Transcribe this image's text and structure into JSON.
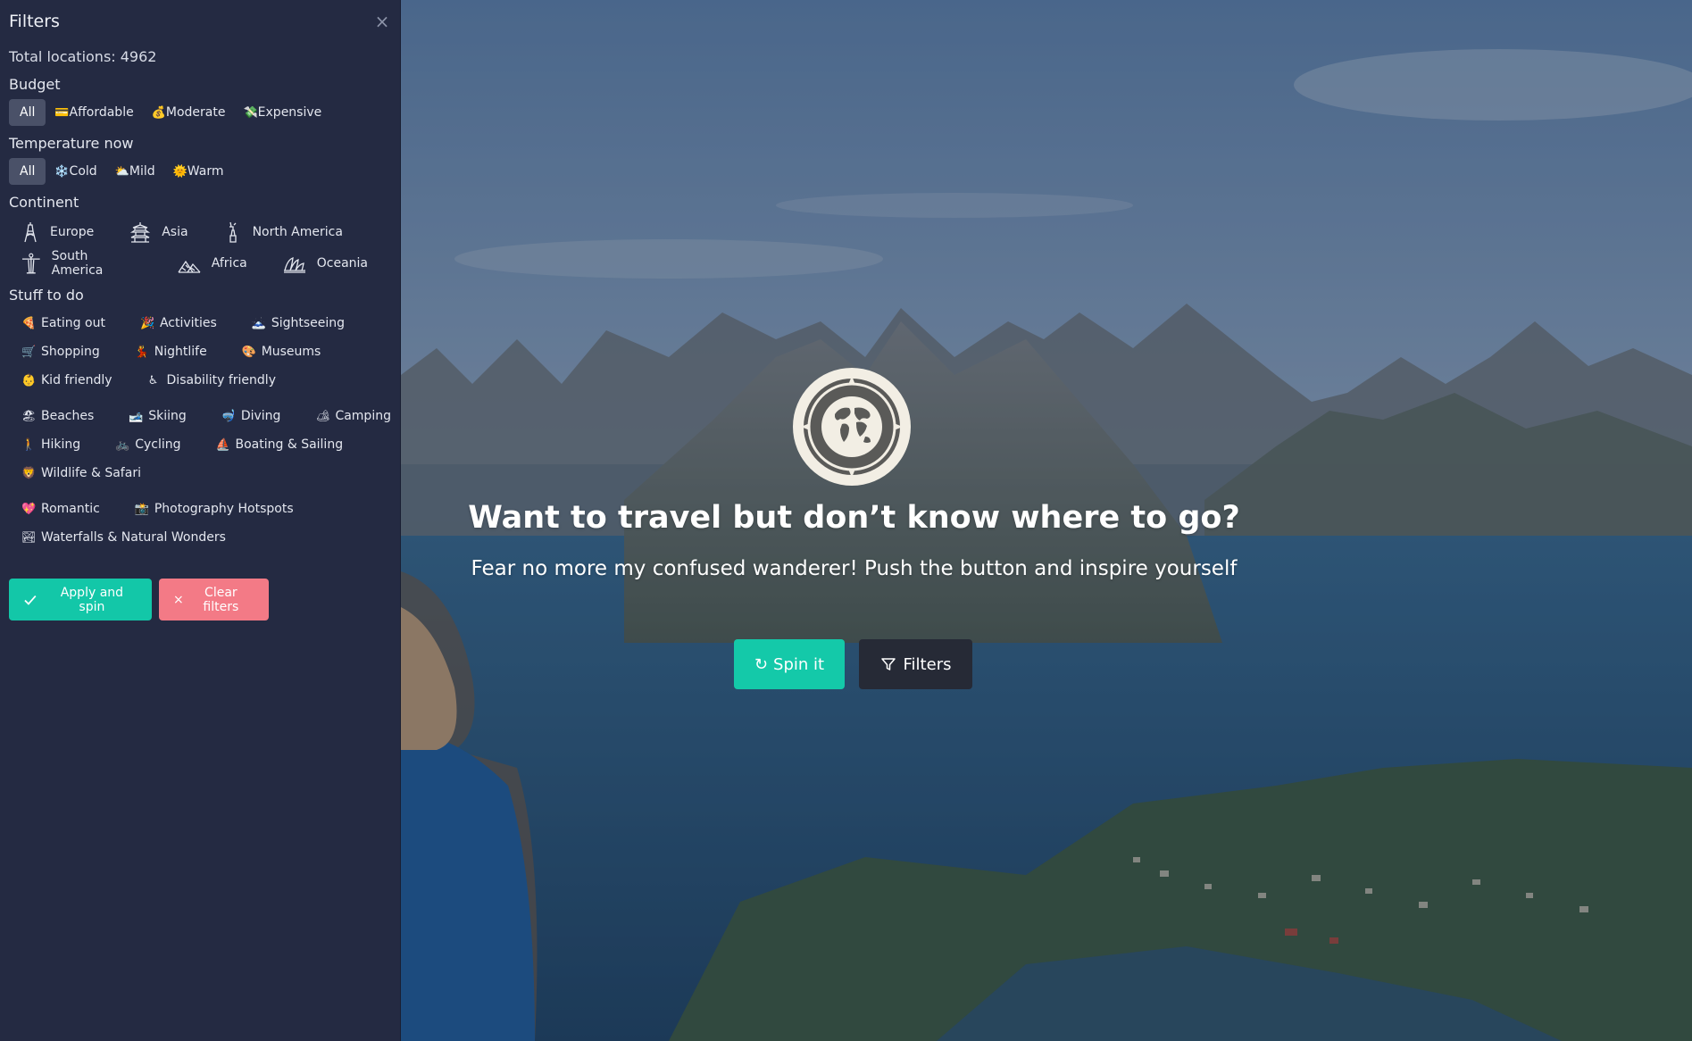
{
  "sidebar": {
    "title": "Filters",
    "close_label": "×",
    "total_locations": "Total locations: 4962",
    "budget": {
      "title": "Budget",
      "options": [
        {
          "emoji": "",
          "label": "All",
          "active": true
        },
        {
          "emoji": "💳",
          "label": "Affordable",
          "active": false
        },
        {
          "emoji": "💰",
          "label": "Moderate",
          "active": false
        },
        {
          "emoji": "💸",
          "label": "Expensive",
          "active": false
        }
      ]
    },
    "temperature": {
      "title": "Temperature now",
      "options": [
        {
          "emoji": "",
          "label": "All",
          "active": true
        },
        {
          "emoji": "❄️",
          "label": "Cold",
          "active": false
        },
        {
          "emoji": "⛅",
          "label": "Mild",
          "active": false
        },
        {
          "emoji": "🌞",
          "label": "Warm",
          "active": false
        }
      ]
    },
    "continent": {
      "title": "Continent",
      "items": [
        {
          "label": "Europe",
          "icon": "eiffel-tower-icon"
        },
        {
          "label": "Asia",
          "icon": "pagoda-icon"
        },
        {
          "label": "North America",
          "icon": "statue-of-liberty-icon"
        },
        {
          "label": "South America",
          "icon": "christ-redeemer-icon"
        },
        {
          "label": "Africa",
          "icon": "pyramids-icon"
        },
        {
          "label": "Oceania",
          "icon": "opera-house-icon"
        }
      ]
    },
    "stuff": {
      "title": "Stuff to do",
      "items": [
        {
          "emoji": "🍕",
          "label": "Eating out"
        },
        {
          "emoji": "🎉",
          "label": "Activities"
        },
        {
          "emoji": "🗻",
          "label": "Sightseeing"
        },
        {
          "emoji": "🛒",
          "label": "Shopping"
        },
        {
          "emoji": "💃",
          "label": "Nightlife"
        },
        {
          "emoji": "🎨",
          "label": "Museums"
        },
        {
          "emoji": "👶",
          "label": "Kid friendly"
        },
        {
          "emoji": "♿",
          "label": "Disability friendly"
        },
        {
          "emoji": "🏖",
          "label": "Beaches"
        },
        {
          "emoji": "🎿",
          "label": "Skiing"
        },
        {
          "emoji": "🤿",
          "label": "Diving"
        },
        {
          "emoji": "🏕",
          "label": "Camping"
        },
        {
          "emoji": "🚶",
          "label": "Hiking"
        },
        {
          "emoji": "🚲",
          "label": "Cycling"
        },
        {
          "emoji": "⛵",
          "label": "Boating & Sailing"
        },
        {
          "emoji": "🦁",
          "label": "Wildlife & Safari"
        },
        {
          "emoji": "💖",
          "label": "Romantic"
        },
        {
          "emoji": "📸",
          "label": "Photography Hotspots"
        },
        {
          "emoji": "🏞",
          "label": "Waterfalls & Natural Wonders"
        }
      ]
    },
    "apply_label": "Apply and spin",
    "clear_label": "Clear filters",
    "clear_prefix": "×"
  },
  "hero": {
    "headline": "Want to travel but don’t know where to go?",
    "subline": "Fear no more my confused wanderer! Push the button and inspire yourself",
    "spin_label": "Spin it",
    "spin_icon": "↻",
    "filters_label": "Filters"
  },
  "colors": {
    "sidebar_bg": "#242a42",
    "accent": "#13c7a8",
    "danger": "#f37a86",
    "dark_button": "#262a36",
    "logo_cream": "#f2eee4"
  }
}
